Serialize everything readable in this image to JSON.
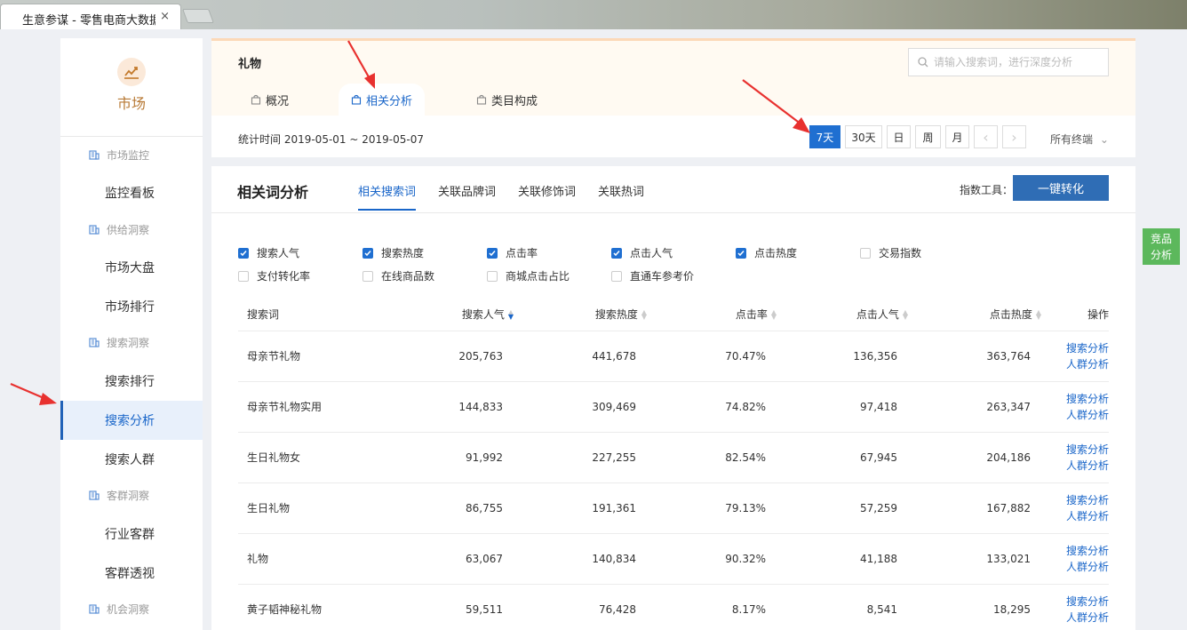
{
  "browser": {
    "tab_title": "生意参谋 - 零售电商大数据",
    "close_glyph": "×"
  },
  "sidebar": {
    "brand_label": "市场",
    "groups": [
      {
        "label": "市场监控",
        "items": [
          "监控看板"
        ]
      },
      {
        "label": "供给洞察",
        "items": [
          "市场大盘",
          "市场排行"
        ]
      },
      {
        "label": "搜索洞察",
        "items": [
          "搜索排行",
          "搜索分析",
          "搜索人群"
        ]
      },
      {
        "label": "客群洞察",
        "items": [
          "行业客群",
          "客群透视"
        ]
      },
      {
        "label": "机会洞察",
        "items": []
      }
    ],
    "active_item": "搜索分析"
  },
  "header": {
    "title": "礼物",
    "search_placeholder": "请输入搜索词，进行深度分析",
    "tabs": [
      "概况",
      "相关分析",
      "类目构成"
    ],
    "active_tab": "相关分析",
    "stat_time": "统计时间 2019-05-01 ~ 2019-05-07",
    "periods": [
      "7天",
      "30天",
      "日",
      "周",
      "月"
    ],
    "active_period": "7天",
    "prev_glyph": "‹",
    "next_glyph": "›",
    "terminal": "所有终端",
    "terminal_chevron": "⌄"
  },
  "main": {
    "title": "相关词分析",
    "tabs": [
      "相关搜索词",
      "关联品牌词",
      "关联修饰词",
      "关联热词"
    ],
    "active_tab": "相关搜索词",
    "tool_label": "指数工具：",
    "convert_button": "一键转化",
    "checkboxes": [
      {
        "label": "搜索人气",
        "checked": true
      },
      {
        "label": "搜索热度",
        "checked": true
      },
      {
        "label": "点击率",
        "checked": true
      },
      {
        "label": "点击人气",
        "checked": true
      },
      {
        "label": "点击热度",
        "checked": true
      },
      {
        "label": "交易指数",
        "checked": false
      },
      {
        "label": "支付转化率",
        "checked": false
      },
      {
        "label": "在线商品数",
        "checked": false
      },
      {
        "label": "商城点击占比",
        "checked": false
      },
      {
        "label": "直通车参考价",
        "checked": false
      }
    ],
    "table": {
      "headers": [
        "搜索词",
        "搜索人气",
        "搜索热度",
        "点击率",
        "点击人气",
        "点击热度",
        "操作"
      ],
      "rows": [
        {
          "word": "母亲节礼物",
          "search_pop": "205,763",
          "search_heat": "441,678",
          "ctr": "70.47%",
          "click_pop": "136,356",
          "click_heat": "363,764"
        },
        {
          "word": "母亲节礼物实用",
          "search_pop": "144,833",
          "search_heat": "309,469",
          "ctr": "74.82%",
          "click_pop": "97,418",
          "click_heat": "263,347"
        },
        {
          "word": "生日礼物女",
          "search_pop": "91,992",
          "search_heat": "227,255",
          "ctr": "82.54%",
          "click_pop": "67,945",
          "click_heat": "204,186"
        },
        {
          "word": "生日礼物",
          "search_pop": "86,755",
          "search_heat": "191,361",
          "ctr": "79.13%",
          "click_pop": "57,259",
          "click_heat": "167,882"
        },
        {
          "word": "礼物",
          "search_pop": "63,067",
          "search_heat": "140,834",
          "ctr": "90.32%",
          "click_pop": "41,188",
          "click_heat": "133,021"
        },
        {
          "word": "黄子韬神秘礼物",
          "search_pop": "59,511",
          "search_heat": "76,428",
          "ctr": "8.17%",
          "click_pop": "8,541",
          "click_heat": "18,295"
        }
      ],
      "op_links": [
        "搜索分析",
        "人群分析"
      ]
    }
  },
  "float": {
    "line1": "竞品",
    "line2": "分析"
  },
  "colors": {
    "accent": "#1f6fd1",
    "brand": "#b87a36",
    "convert": "#2f6db5",
    "float": "#5cb85c",
    "arrow": "#e8312f"
  }
}
